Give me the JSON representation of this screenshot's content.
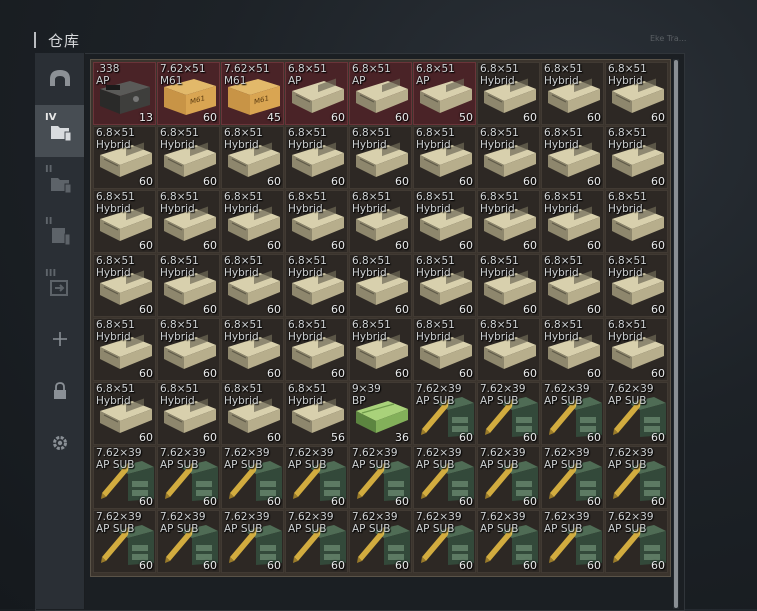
{
  "header": {
    "title": "仓库",
    "faint_text": "Eke Tra..."
  },
  "sidebar": {
    "items": [
      {
        "name": "helmet-icon",
        "label": ""
      },
      {
        "name": "storage-tier-iv",
        "label": "IV"
      },
      {
        "name": "storage-tier-ii",
        "label": "II"
      },
      {
        "name": "storage-tier-ii-b",
        "label": "II"
      },
      {
        "name": "storage-tier-iii",
        "label": "III"
      },
      {
        "name": "add-icon",
        "label": ""
      },
      {
        "name": "lock-icon",
        "label": ""
      },
      {
        "name": "gear-icon",
        "label": ""
      }
    ]
  },
  "colors": {
    "red_cell": "#4a2327",
    "cell": "#2d2824",
    "accent": "#b9bcc0"
  },
  "items": [
    {
      "name": ".338\nAP",
      "count": "13",
      "icon": "black-ammo-case",
      "red": true
    },
    {
      "name": "7.62×51\nM61",
      "count": "60",
      "icon": "wooden-crate",
      "red": true
    },
    {
      "name": "7.62×51\nM61",
      "count": "45",
      "icon": "wooden-crate",
      "red": true
    },
    {
      "name": "6.8×51\nAP",
      "count": "60",
      "icon": "ammo-box",
      "red": true
    },
    {
      "name": "6.8×51\nAP",
      "count": "60",
      "icon": "ammo-box",
      "red": true
    },
    {
      "name": "6.8×51\nAP",
      "count": "50",
      "icon": "ammo-box",
      "red": true
    },
    {
      "name": "6.8×51\nHybrid",
      "count": "60",
      "icon": "ammo-box",
      "red": false
    },
    {
      "name": "6.8×51\nHybrid",
      "count": "60",
      "icon": "ammo-box",
      "red": false
    },
    {
      "name": "6.8×51\nHybrid",
      "count": "60",
      "icon": "ammo-box",
      "red": false
    },
    {
      "name": "6.8×51\nHybrid",
      "count": "60",
      "icon": "ammo-box",
      "red": false
    },
    {
      "name": "6.8×51\nHybrid",
      "count": "60",
      "icon": "ammo-box",
      "red": false
    },
    {
      "name": "6.8×51\nHybrid",
      "count": "60",
      "icon": "ammo-box",
      "red": false
    },
    {
      "name": "6.8×51\nHybrid",
      "count": "60",
      "icon": "ammo-box",
      "red": false
    },
    {
      "name": "6.8×51\nHybrid",
      "count": "60",
      "icon": "ammo-box",
      "red": false
    },
    {
      "name": "6.8×51\nHybrid",
      "count": "60",
      "icon": "ammo-box",
      "red": false
    },
    {
      "name": "6.8×51\nHybrid",
      "count": "60",
      "icon": "ammo-box",
      "red": false
    },
    {
      "name": "6.8×51\nHybrid",
      "count": "60",
      "icon": "ammo-box",
      "red": false
    },
    {
      "name": "6.8×51\nHybrid",
      "count": "60",
      "icon": "ammo-box",
      "red": false
    },
    {
      "name": "6.8×51\nHybrid",
      "count": "60",
      "icon": "ammo-box",
      "red": false
    },
    {
      "name": "6.8×51\nHybrid",
      "count": "60",
      "icon": "ammo-box",
      "red": false
    },
    {
      "name": "6.8×51\nHybrid",
      "count": "60",
      "icon": "ammo-box",
      "red": false
    },
    {
      "name": "6.8×51\nHybrid",
      "count": "60",
      "icon": "ammo-box",
      "red": false
    },
    {
      "name": "6.8×51\nHybrid",
      "count": "60",
      "icon": "ammo-box",
      "red": false
    },
    {
      "name": "6.8×51\nHybrid",
      "count": "60",
      "icon": "ammo-box",
      "red": false
    },
    {
      "name": "6.8×51\nHybrid",
      "count": "60",
      "icon": "ammo-box",
      "red": false
    },
    {
      "name": "6.8×51\nHybrid",
      "count": "60",
      "icon": "ammo-box",
      "red": false
    },
    {
      "name": "6.8×51\nHybrid",
      "count": "60",
      "icon": "ammo-box",
      "red": false
    },
    {
      "name": "6.8×51\nHybrid",
      "count": "60",
      "icon": "ammo-box",
      "red": false
    },
    {
      "name": "6.8×51\nHybrid",
      "count": "60",
      "icon": "ammo-box",
      "red": false
    },
    {
      "name": "6.8×51\nHybrid",
      "count": "60",
      "icon": "ammo-box",
      "red": false
    },
    {
      "name": "6.8×51\nHybrid",
      "count": "60",
      "icon": "ammo-box",
      "red": false
    },
    {
      "name": "6.8×51\nHybrid",
      "count": "60",
      "icon": "ammo-box",
      "red": false
    },
    {
      "name": "6.8×51\nHybrid",
      "count": "60",
      "icon": "ammo-box",
      "red": false
    },
    {
      "name": "6.8×51\nHybrid",
      "count": "60",
      "icon": "ammo-box",
      "red": false
    },
    {
      "name": "6.8×51\nHybrid",
      "count": "60",
      "icon": "ammo-box",
      "red": false
    },
    {
      "name": "6.8×51\nHybrid",
      "count": "60",
      "icon": "ammo-box",
      "red": false
    },
    {
      "name": "6.8×51\nHybrid",
      "count": "60",
      "icon": "ammo-box",
      "red": false
    },
    {
      "name": "6.8×51\nHybrid",
      "count": "60",
      "icon": "ammo-box",
      "red": false
    },
    {
      "name": "6.8×51\nHybrid",
      "count": "60",
      "icon": "ammo-box",
      "red": false
    },
    {
      "name": "6.8×51\nHybrid",
      "count": "60",
      "icon": "ammo-box",
      "red": false
    },
    {
      "name": "6.8×51\nHybrid",
      "count": "60",
      "icon": "ammo-box",
      "red": false
    },
    {
      "name": "6.8×51\nHybrid",
      "count": "60",
      "icon": "ammo-box",
      "red": false
    },
    {
      "name": "6.8×51\nHybrid",
      "count": "60",
      "icon": "ammo-box",
      "red": false
    },
    {
      "name": "6.8×51\nHybrid",
      "count": "60",
      "icon": "ammo-box",
      "red": false
    },
    {
      "name": "6.8×51\nHybrid",
      "count": "60",
      "icon": "ammo-box",
      "red": false
    },
    {
      "name": "6.8×51\nHybrid",
      "count": "60",
      "icon": "ammo-box",
      "red": false
    },
    {
      "name": "6.8×51\nHybrid",
      "count": "60",
      "icon": "ammo-box",
      "red": false
    },
    {
      "name": "6.8×51\nHybrid",
      "count": "60",
      "icon": "ammo-box",
      "red": false
    },
    {
      "name": "6.8×51\nHybrid",
      "count": "56",
      "icon": "ammo-box",
      "red": false
    },
    {
      "name": "9×39\nBP",
      "count": "36",
      "icon": "green-ammo-box",
      "red": false
    },
    {
      "name": "7.62×39\nAP SUB",
      "count": "60",
      "icon": "green-crate-bullet",
      "red": false
    },
    {
      "name": "7.62×39\nAP SUB",
      "count": "60",
      "icon": "green-crate-bullet",
      "red": false
    },
    {
      "name": "7.62×39\nAP SUB",
      "count": "60",
      "icon": "green-crate-bullet",
      "red": false
    },
    {
      "name": "7.62×39\nAP SUB",
      "count": "60",
      "icon": "green-crate-bullet",
      "red": false
    },
    {
      "name": "7.62×39\nAP SUB",
      "count": "60",
      "icon": "green-crate-bullet",
      "red": false
    },
    {
      "name": "7.62×39\nAP SUB",
      "count": "60",
      "icon": "green-crate-bullet",
      "red": false
    },
    {
      "name": "7.62×39\nAP SUB",
      "count": "60",
      "icon": "green-crate-bullet",
      "red": false
    },
    {
      "name": "7.62×39\nAP SUB",
      "count": "60",
      "icon": "green-crate-bullet",
      "red": false
    },
    {
      "name": "7.62×39\nAP SUB",
      "count": "60",
      "icon": "green-crate-bullet",
      "red": false
    },
    {
      "name": "7.62×39\nAP SUB",
      "count": "60",
      "icon": "green-crate-bullet",
      "red": false
    },
    {
      "name": "7.62×39\nAP SUB",
      "count": "60",
      "icon": "green-crate-bullet",
      "red": false
    },
    {
      "name": "7.62×39\nAP SUB",
      "count": "60",
      "icon": "green-crate-bullet",
      "red": false
    },
    {
      "name": "7.62×39\nAP SUB",
      "count": "60",
      "icon": "green-crate-bullet",
      "red": false
    },
    {
      "name": "7.62×39\nAP SUB",
      "count": "60",
      "icon": "green-crate-bullet",
      "red": false
    },
    {
      "name": "7.62×39\nAP SUB",
      "count": "60",
      "icon": "green-crate-bullet",
      "red": false
    },
    {
      "name": "7.62×39\nAP SUB",
      "count": "60",
      "icon": "green-crate-bullet",
      "red": false
    },
    {
      "name": "7.62×39\nAP SUB",
      "count": "60",
      "icon": "green-crate-bullet",
      "red": false
    },
    {
      "name": "7.62×39\nAP SUB",
      "count": "60",
      "icon": "green-crate-bullet",
      "red": false
    },
    {
      "name": "7.62×39\nAP SUB",
      "count": "60",
      "icon": "green-crate-bullet",
      "red": false
    },
    {
      "name": "7.62×39\nAP SUB",
      "count": "60",
      "icon": "green-crate-bullet",
      "red": false
    },
    {
      "name": "7.62×39\nAP SUB",
      "count": "60",
      "icon": "green-crate-bullet",
      "red": false
    },
    {
      "name": "7.62×39\nAP SUB",
      "count": "60",
      "icon": "green-crate-bullet",
      "red": false
    }
  ]
}
